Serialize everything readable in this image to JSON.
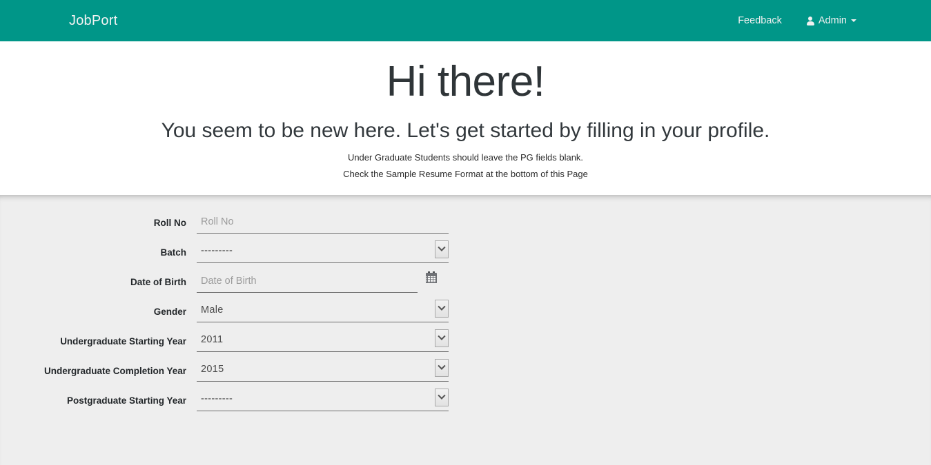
{
  "navbar": {
    "brand": "JobPort",
    "brand_color": "#009688",
    "links": [
      {
        "label": "Feedback",
        "icon": null
      },
      {
        "label": "Admin",
        "icon": "person-icon",
        "caret": true
      }
    ]
  },
  "hero": {
    "title": "Hi there!",
    "subtitle": "You seem to be new here. Let's get started by filling in your profile.",
    "notes": [
      "Under Graduate Students should leave the PG fields blank.",
      "Check the Sample Resume Format at the bottom of this Page"
    ]
  },
  "form": {
    "fields": [
      {
        "label": "Roll No",
        "type": "text",
        "value": "",
        "placeholder": "Roll No",
        "name": "roll-no"
      },
      {
        "label": "Batch",
        "type": "select",
        "value": "---------",
        "name": "batch"
      },
      {
        "label": "Date of Birth",
        "type": "date",
        "value": "",
        "placeholder": "Date of Birth",
        "icon": "calendar-icon",
        "name": "date-of-birth"
      },
      {
        "label": "Gender",
        "type": "select",
        "value": "Male",
        "name": "gender"
      },
      {
        "label": "Undergraduate Starting Year",
        "type": "select",
        "value": "2011",
        "name": "undergraduate-starting-year"
      },
      {
        "label": "Undergraduate Completion Year",
        "type": "select",
        "value": "2015",
        "name": "undergraduate-completion-year"
      },
      {
        "label": "Postgraduate Starting Year",
        "type": "select",
        "value": "---------",
        "name": "postgraduate-starting-year"
      }
    ]
  }
}
